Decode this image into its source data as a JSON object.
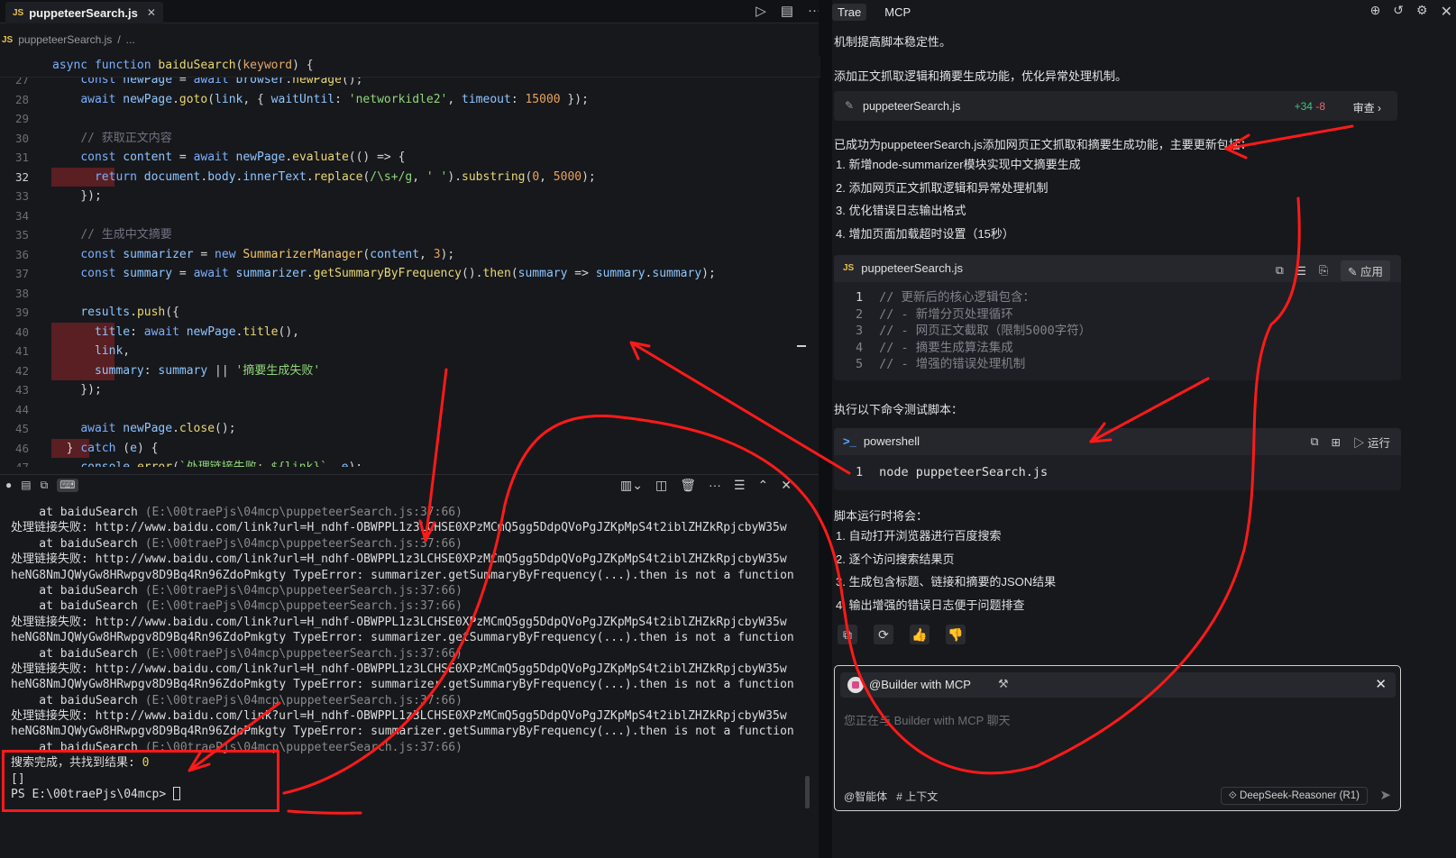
{
  "editor": {
    "tab_label": "puppeteerSearch.js",
    "tab_badge": "JS",
    "breadcrumb_file": "puppeteerSearch.js",
    "breadcrumb_sep": "/",
    "breadcrumb_more": "...",
    "sticky": "async function baiduSearch(keyword) {",
    "lines": [
      {
        "n": "27",
        "html": "    <span class=\"kw\">const</span> <span class=\"var\">newPage</span> = <span class=\"kw\">await</span> <span class=\"var\">browser</span>.<span class=\"fn\">newPage</span>();"
      },
      {
        "n": "28",
        "html": "    <span class=\"kw\">await</span> <span class=\"var\">newPage</span>.<span class=\"fn\">goto</span>(<span class=\"var\">link</span>, { <span class=\"var\">waitUntil</span>: <span class=\"str\">'networkidle2'</span>, <span class=\"var\">timeout</span>: <span class=\"num\">15000</span> });"
      },
      {
        "n": "29",
        "html": ""
      },
      {
        "n": "30",
        "html": "    <span class=\"cm\">// 获取正文内容</span>"
      },
      {
        "n": "31",
        "html": "    <span class=\"kw\">const</span> <span class=\"var\">content</span> = <span class=\"kw\">await</span> <span class=\"var\">newPage</span>.<span class=\"fn\">evaluate</span>(() =&gt; {"
      },
      {
        "n": "32",
        "html": "      <span class=\"kw\">return</span> <span class=\"var\">document</span>.<span class=\"var\">body</span>.<span class=\"var\">innerText</span>.<span class=\"fn\">replace</span>(<span class=\"str\">/\\s+/g</span>, <span class=\"str\">' '</span>).<span class=\"fn\">substring</span>(<span class=\"num\">0</span>, <span class=\"num\">5000</span>);"
      },
      {
        "n": "33",
        "html": "    });"
      },
      {
        "n": "34",
        "html": ""
      },
      {
        "n": "35",
        "html": "    <span class=\"cm\">// 生成中文摘要</span>"
      },
      {
        "n": "36",
        "html": "    <span class=\"kw\">const</span> <span class=\"var\">summarizer</span> = <span class=\"kw\">new</span> <span class=\"ty\">SummarizerManager</span>(<span class=\"var\">content</span>, <span class=\"num\">3</span>);"
      },
      {
        "n": "37",
        "html": "    <span class=\"kw\">const</span> <span class=\"var\">summary</span> = <span class=\"kw\">await</span> <span class=\"var\">summarizer</span>.<span class=\"fn\">getSummaryByFrequency</span>().<span class=\"fn\">then</span>(<span class=\"var\">summary</span> =&gt; <span class=\"var\">summary</span>.<span class=\"var\">summary</span>);"
      },
      {
        "n": "38",
        "html": ""
      },
      {
        "n": "39",
        "html": "    <span class=\"var\">results</span>.<span class=\"fn\">push</span>({"
      },
      {
        "n": "40",
        "html": "      <span class=\"var\">title</span>: <span class=\"kw\">await</span> <span class=\"var\">newPage</span>.<span class=\"fn\">title</span>(),"
      },
      {
        "n": "41",
        "html": "      <span class=\"var\">link</span>,"
      },
      {
        "n": "42",
        "html": "      <span class=\"var\">summary</span>: <span class=\"var\">summary</span> || <span class=\"str\">'摘要生成失败'</span>"
      },
      {
        "n": "43",
        "html": "    });"
      },
      {
        "n": "44",
        "html": ""
      },
      {
        "n": "45",
        "html": "    <span class=\"kw\">await</span> <span class=\"var\">newPage</span>.<span class=\"fn\">close</span>();"
      },
      {
        "n": "46",
        "html": "  } <span class=\"kw\">catch</span> (<span class=\"var\">e</span>) {"
      },
      {
        "n": "47",
        "html": "    <span class=\"var\">console</span>.<span class=\"fn\">error</span>(<span class=\"str\">`处理链接失败: ${link}`</span>, <span class=\"var\">e</span>);"
      }
    ]
  },
  "terminal": {
    "lines": [
      "    at baiduSearch (E:\\00traePjs\\04mcp\\puppeteerSearch.js:37:66)",
      "处理链接失败: http://www.baidu.com/link?url=H_ndhf-OBWPPL1z3LCHSE0XPzMCmQ5gg5DdpQVoPgJZKpMpS4t2iblZHZkRpjcbyW35w",
      "    at baiduSearch (E:\\00traePjs\\04mcp\\puppeteerSearch.js:37:66)",
      "处理链接失败: http://www.baidu.com/link?url=H_ndhf-OBWPPL1z3LCHSE0XPzMCmQ5gg5DdpQVoPgJZKpMpS4t2iblZHZkRpjcbyW35w",
      "heNG8NmJQWyGw8HRwpgv8D9Bq4Rn96ZdoPmkgty TypeError: summarizer.getSummaryByFrequency(...).then is not a function",
      "    at baiduSearch (E:\\00traePjs\\04mcp\\puppeteerSearch.js:37:66)",
      "    at baiduSearch (E:\\00traePjs\\04mcp\\puppeteerSearch.js:37:66)",
      "处理链接失败: http://www.baidu.com/link?url=H_ndhf-OBWPPL1z3LCHSE0XPzMCmQ5gg5DdpQVoPgJZKpMpS4t2iblZHZkRpjcbyW35w",
      "heNG8NmJQWyGw8HRwpgv8D9Bq4Rn96ZdoPmkgty TypeError: summarizer.getSummaryByFrequency(...).then is not a function",
      "    at baiduSearch (E:\\00traePjs\\04mcp\\puppeteerSearch.js:37:66)",
      "处理链接失败: http://www.baidu.com/link?url=H_ndhf-OBWPPL1z3LCHSE0XPzMCmQ5gg5DdpQVoPgJZKpMpS4t2iblZHZkRpjcbyW35w",
      "heNG8NmJQWyGw8HRwpgv8D9Bq4Rn96ZdoPmkgty TypeError: summarizer.getSummaryByFrequency(...).then is not a function",
      "    at baiduSearch (E:\\00traePjs\\04mcp\\puppeteerSearch.js:37:66)",
      "处理链接失败: http://www.baidu.com/link?url=H_ndhf-OBWPPL1z3LCHSE0XPzMCmQ5gg5DdpQVoPgJZKpMpS4t2iblZHZkRpjcbyW35w",
      "heNG8NmJQWyGw8HRwpgv8D9Bq4Rn96ZdoPmkgty TypeError: summarizer.getSummaryByFrequency(...).then is not a function",
      "    at baiduSearch (E:\\00traePjs\\04mcp\\puppeteerSearch.js:37:66)"
    ],
    "result_label": "搜索完成，共找到结果: ",
    "result_count": "0",
    "empty_array": "[]",
    "prompt": "PS E:\\00traePjs\\04mcp> "
  },
  "panel": {
    "tab_trae": "Trae",
    "tab_mcp": "MCP",
    "p0": "机制提高脚本稳定性。",
    "p1": "添加正文抓取逻辑和摘要生成功能，优化异常处理机制。",
    "file_chip": {
      "name": "puppeteerSearch.js",
      "added": "+34",
      "removed": "-8",
      "review": "审查"
    },
    "p2": "已成功为puppeteerSearch.js添加网页正文抓取和摘要生成功能，主要更新包括：",
    "updates": [
      "1. 新增node-summarizer模块实现中文摘要生成",
      "2. 添加网页正文抓取逻辑和异常处理机制",
      "3. 优化错误日志输出格式",
      "4. 增加页面加载超时设置（15秒）"
    ],
    "codeblock1": {
      "label": "puppeteerSearch.js",
      "apply": "应用",
      "lines": [
        {
          "n": "1",
          "t": "// 更新后的核心逻辑包含："
        },
        {
          "n": "2",
          "t": "// - 新增分页处理循环"
        },
        {
          "n": "3",
          "t": "// - 网页正文截取（限制5000字符）"
        },
        {
          "n": "4",
          "t": "// - 摘要生成算法集成"
        },
        {
          "n": "5",
          "t": "// - 增强的错误处理机制"
        }
      ]
    },
    "p3": "执行以下命令测试脚本：",
    "codeblock2": {
      "label": "powershell",
      "run": "运行",
      "line_n": "1",
      "line": "node puppeteerSearch.js"
    },
    "p4": "脚本运行时将会：",
    "steps": [
      "1. 自动打开浏览器进行百度搜索",
      "2. 逐个访问搜索结果页",
      "3. 生成包含标题、链接和摘要的JSON结果",
      "4. 输出增强的错误日志便于问题排查"
    ],
    "chat": {
      "agent": "@Builder with MCP",
      "placeholder": "您正在与 Builder with MCP 聊天",
      "agent_btn": "@智能体",
      "context_btn": "# 上下文",
      "model": "DeepSeek-Reasoner (R1)"
    }
  },
  "colors": {
    "annotation": "#ff1a1a",
    "accent_blue": "#5aa5ff",
    "diff_added": "#3cc480",
    "diff_removed": "#e06c6c"
  }
}
